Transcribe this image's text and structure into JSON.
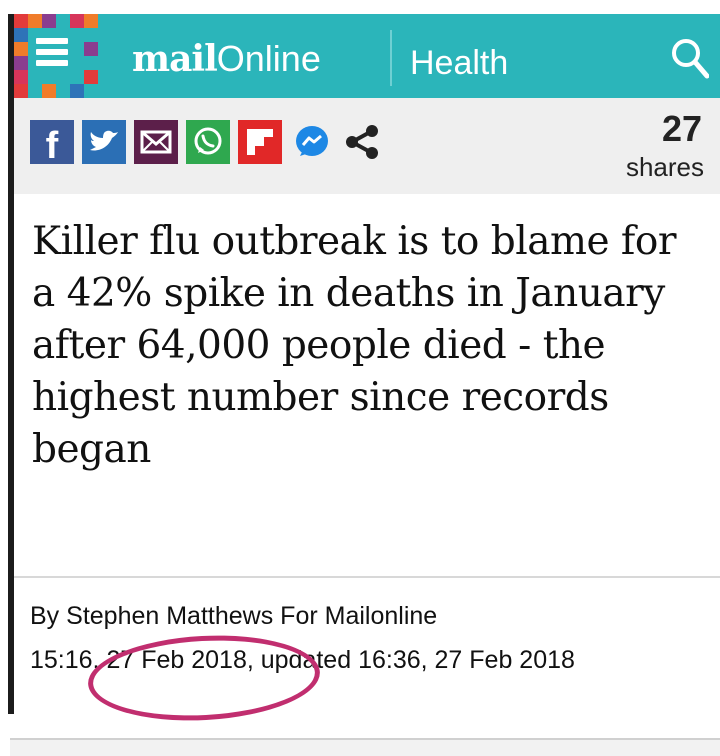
{
  "header": {
    "brand_bold": "mail",
    "brand_light": "Online",
    "section": "Health",
    "icons": [
      "menu-icon",
      "search-icon"
    ],
    "color": "#2bb5ba"
  },
  "sharebar": {
    "buttons": [
      {
        "name": "facebook-share-button",
        "glyph": "f",
        "color": "#3b5998"
      },
      {
        "name": "twitter-share-button",
        "glyph": "t",
        "color": "#2b6fb5"
      },
      {
        "name": "email-share-button",
        "glyph": "✉",
        "color": "#5c1f4a"
      },
      {
        "name": "whatsapp-share-button",
        "glyph": "✆",
        "color": "#2fa84f"
      },
      {
        "name": "flipboard-share-button",
        "glyph": "F",
        "color": "#e12828"
      },
      {
        "name": "messenger-share-button",
        "glyph": "m",
        "color": "#1e88e5"
      },
      {
        "name": "more-share-button",
        "glyph": "share",
        "color": "#222222"
      }
    ],
    "share_count": "27",
    "share_label": "shares"
  },
  "article": {
    "headline": "Killer flu outbreak is to blame for a 42% spike in deaths in January after 64,000 people died - the highest number since records began",
    "byline_prefix": "By",
    "byline_author": "Stephen Matthews",
    "byline_suffix": "For Mailonline",
    "published": "15:16, 27 Feb 2018",
    "updated_label": ", updated",
    "updated": "16:36, 27 Feb 2018"
  },
  "annotation": {
    "color": "#c12e6f"
  }
}
